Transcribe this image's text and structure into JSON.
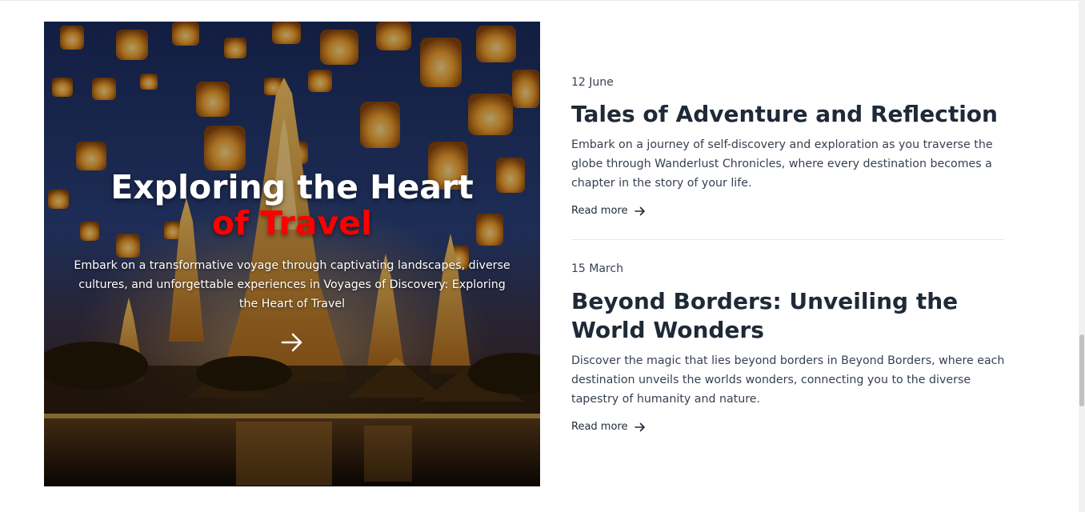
{
  "hero": {
    "title_line1": "Exploring the Heart",
    "title_line2": "of Travel",
    "description": "Embark on a transformative voyage through captivating landscapes, diverse cultures, and unforgettable experiences in Voyages of Discovery: Exploring the Heart of Travel",
    "arrow_icon": "arrow-right-icon",
    "accent_color": "#ff0000"
  },
  "articles": [
    {
      "date": "12 June",
      "title": "Tales of Adventure and Reflection",
      "excerpt": "Embark on a journey of self-discovery and exploration as you traverse the globe through Wanderlust Chronicles, where every destination becomes a chapter in the story of your life.",
      "read_more": "Read more"
    },
    {
      "date": "15 March",
      "title": "Beyond Borders: Unveiling the World Wonders",
      "excerpt": "Discover the magic that lies beyond borders in Beyond Borders, where each destination unveils the worlds wonders, connecting you to the diverse tapestry of humanity and nature.",
      "read_more": "Read more"
    }
  ]
}
